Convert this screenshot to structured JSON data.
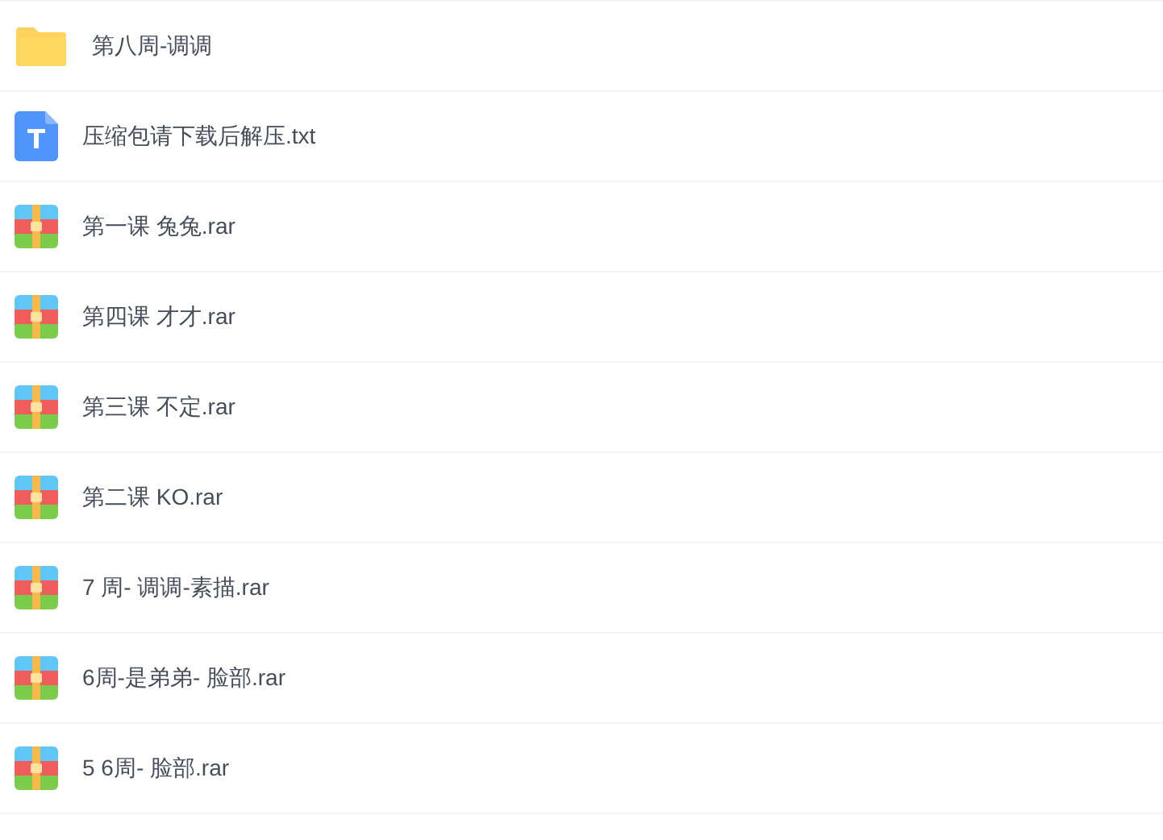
{
  "files": [
    {
      "kind": "folder",
      "name": "第八周-调调"
    },
    {
      "kind": "txt",
      "name": "压缩包请下载后解压.txt"
    },
    {
      "kind": "rar",
      "name": "第一课 兔兔.rar"
    },
    {
      "kind": "rar",
      "name": "第四课 才才.rar"
    },
    {
      "kind": "rar",
      "name": "第三课 不定.rar"
    },
    {
      "kind": "rar",
      "name": "第二课 KO.rar"
    },
    {
      "kind": "rar",
      "name": "7 周- 调调-素描.rar"
    },
    {
      "kind": "rar",
      "name": "6周-是弟弟- 脸部.rar"
    },
    {
      "kind": "rar",
      "name": "5 6周- 脸部.rar"
    }
  ]
}
